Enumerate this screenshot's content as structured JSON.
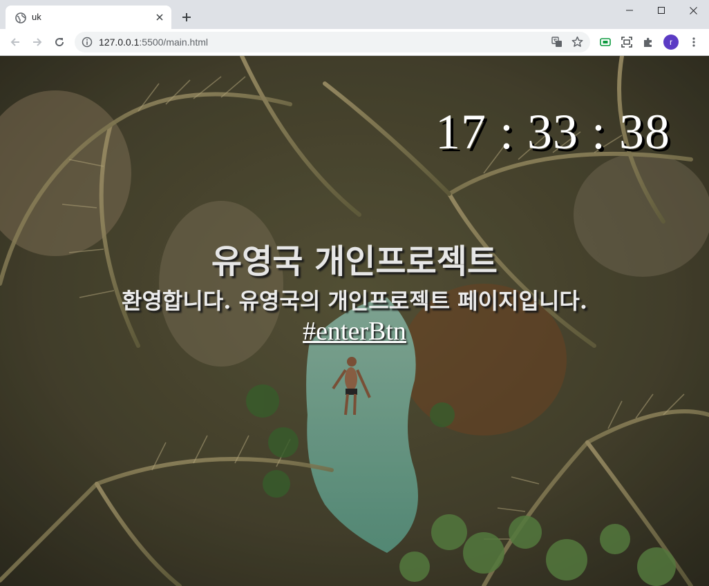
{
  "browser": {
    "tab": {
      "title": "uk",
      "favicon": "globe-icon"
    },
    "url_host": "127.0.0.1",
    "url_rest": ":5500/main.html",
    "profile_initial": "r",
    "colors": {
      "tabstrip": "#dee1e6",
      "toolbar": "#ffffff",
      "profile": "#5b3bc4"
    }
  },
  "page": {
    "clock": "17 : 33 : 38",
    "headline": "유영국 개인프로젝트",
    "subline": "환영합니다. 유영국의 개인프로젝트 페이지입니다.",
    "enter_link": "#enterBtn",
    "background": "aerial-palm-pool-photo"
  }
}
